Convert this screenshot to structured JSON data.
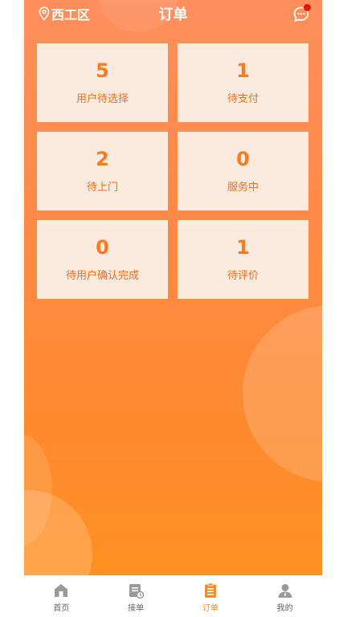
{
  "header": {
    "location": "西工区",
    "title": "订单",
    "location_icon": "location-pin-icon",
    "message_icon": "message-bubble-icon",
    "message_badge_color": "#e8120c"
  },
  "stats": [
    {
      "value": "5",
      "label": "用户待选择"
    },
    {
      "value": "1",
      "label": "待支付"
    },
    {
      "value": "2",
      "label": "待上门"
    },
    {
      "value": "0",
      "label": "服务中"
    },
    {
      "value": "0",
      "label": "待用户确认完成"
    },
    {
      "value": "1",
      "label": "待评价"
    }
  ],
  "tabbar": {
    "items": [
      {
        "label": "首页",
        "icon": "home-icon"
      },
      {
        "label": "接单",
        "icon": "receive-order-icon"
      },
      {
        "label": "订单",
        "icon": "order-clipboard-icon",
        "active": true
      },
      {
        "label": "我的",
        "icon": "profile-icon"
      }
    ]
  },
  "colors": {
    "accent": "#ff8a1f",
    "card_bg": "#fdeadf",
    "gradient_top": "#fe8f5d",
    "gradient_bottom": "#fe9021"
  }
}
